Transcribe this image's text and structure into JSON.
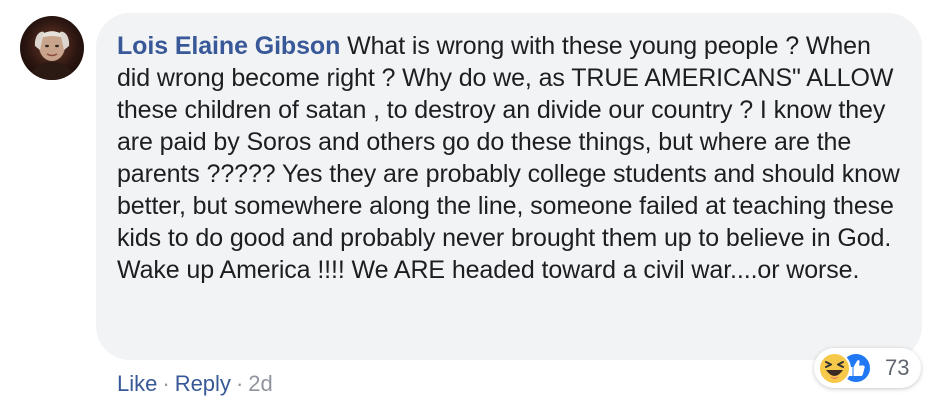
{
  "comment": {
    "author": "Lois Elaine Gibson",
    "text": " What is wrong with these young people ? When did wrong become right ? Why do we, as TRUE AMERICANS\" ALLOW these children of satan , to destroy an divide our country ? I know they are paid by Soros and others go do these things, but where are the parents ????? Yes they are probably college students and should know better, but somewhere along the line, someone failed at teaching these kids to do good and probably never brought them up to believe in God. Wake up America !!!! We ARE headed toward a civil war....or worse."
  },
  "actions": {
    "like_label": "Like",
    "separator": "·",
    "reply_label": "Reply",
    "time": "2d"
  },
  "reactions": {
    "count": "73",
    "icons": [
      "haha-icon",
      "like-icon"
    ],
    "colors": {
      "like": "#2078f4",
      "haha": "#f7c94a"
    }
  },
  "colors": {
    "author": "#385898",
    "text": "#1c1e21",
    "bubble": "#f2f3f5",
    "meta": "#90949c"
  }
}
